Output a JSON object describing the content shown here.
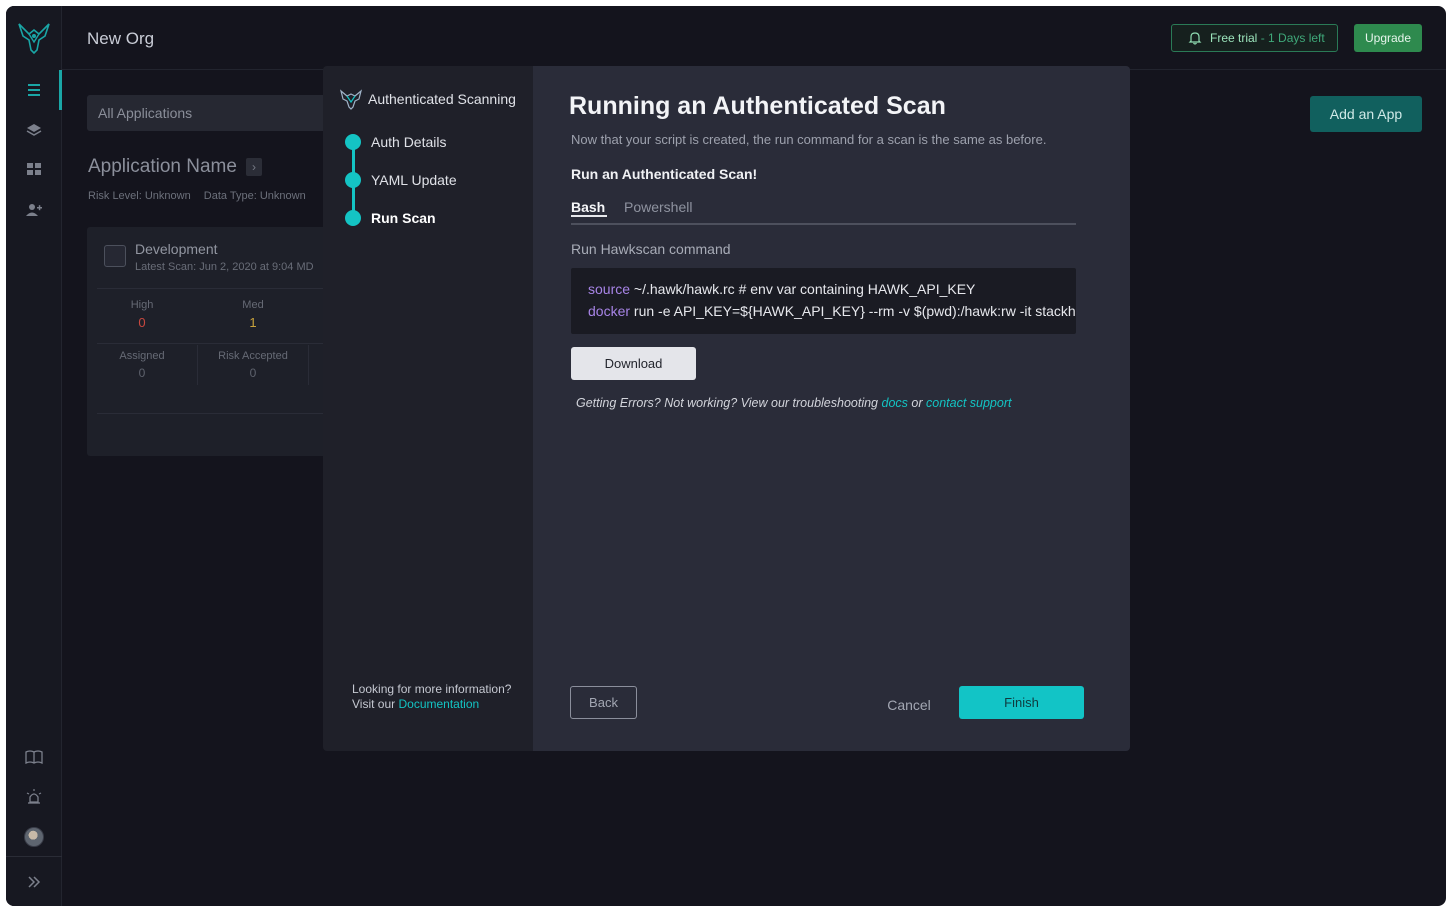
{
  "header": {
    "org_name": "New Org",
    "trial_label": "Free trial",
    "trial_sep": "-",
    "trial_days": "1 Days left",
    "upgrade_label": "Upgrade"
  },
  "sidebar": {
    "icons": [
      "menu-icon",
      "layers-icon",
      "dashboard-icon",
      "add-user-icon",
      "book-icon",
      "alarm-icon",
      "avatar",
      "double-chevron-right-icon"
    ]
  },
  "background": {
    "all_apps": "All Applications",
    "add_app": "Add an App",
    "app_name": "Application Name",
    "risk_level": "Risk Level: Unknown",
    "data_type": "Data Type: Unknown",
    "card": {
      "title": "Development",
      "latest_scan": "Latest Scan: Jun 2, 2020 at 9:04 MD",
      "high_label": "High",
      "high_value": "0",
      "med_label": "Med",
      "med_value": "1",
      "assigned_label": "Assigned",
      "assigned_value": "0",
      "risk_accepted_label": "Risk Accepted",
      "risk_accepted_value": "0"
    }
  },
  "modal": {
    "left": {
      "title": "Authenticated Scanning",
      "steps": [
        "Auth Details",
        "YAML Update",
        "Run Scan"
      ],
      "info_line1": "Looking for more information?",
      "info_prefix": "Visit our",
      "info_link": "Documentation"
    },
    "right": {
      "title": "Running an Authenticated Scan",
      "description": "Now that your script is created, the run command for a scan is the same as before.",
      "subtitle": "Run an Authenticated Scan!",
      "tabs": [
        "Bash",
        "Powershell"
      ],
      "run_label": "Run Hawkscan command",
      "code": {
        "line1_kw": "source",
        "line1_rest": "~/.hawk/hawk.rc # env var containing HAWK_API_KEY",
        "line2_kw": "docker",
        "line2_rest": "run -e API_KEY=${HAWK_API_KEY} --rm -v $(pwd):/hawk:rw -it stackhawk/hawkscan:latest"
      },
      "download": "Download",
      "help_text": "Getting Errors? Not working? View our troubleshooting",
      "help_docs": "docs",
      "help_or": "or",
      "help_support": "contact support",
      "back": "Back",
      "cancel": "Cancel",
      "finish": "Finish"
    }
  },
  "colors": {
    "accent": "#14c4c4",
    "trial_green": "#2e8a4e",
    "background": "#14141d",
    "modal_panel": "#2a2c39"
  }
}
